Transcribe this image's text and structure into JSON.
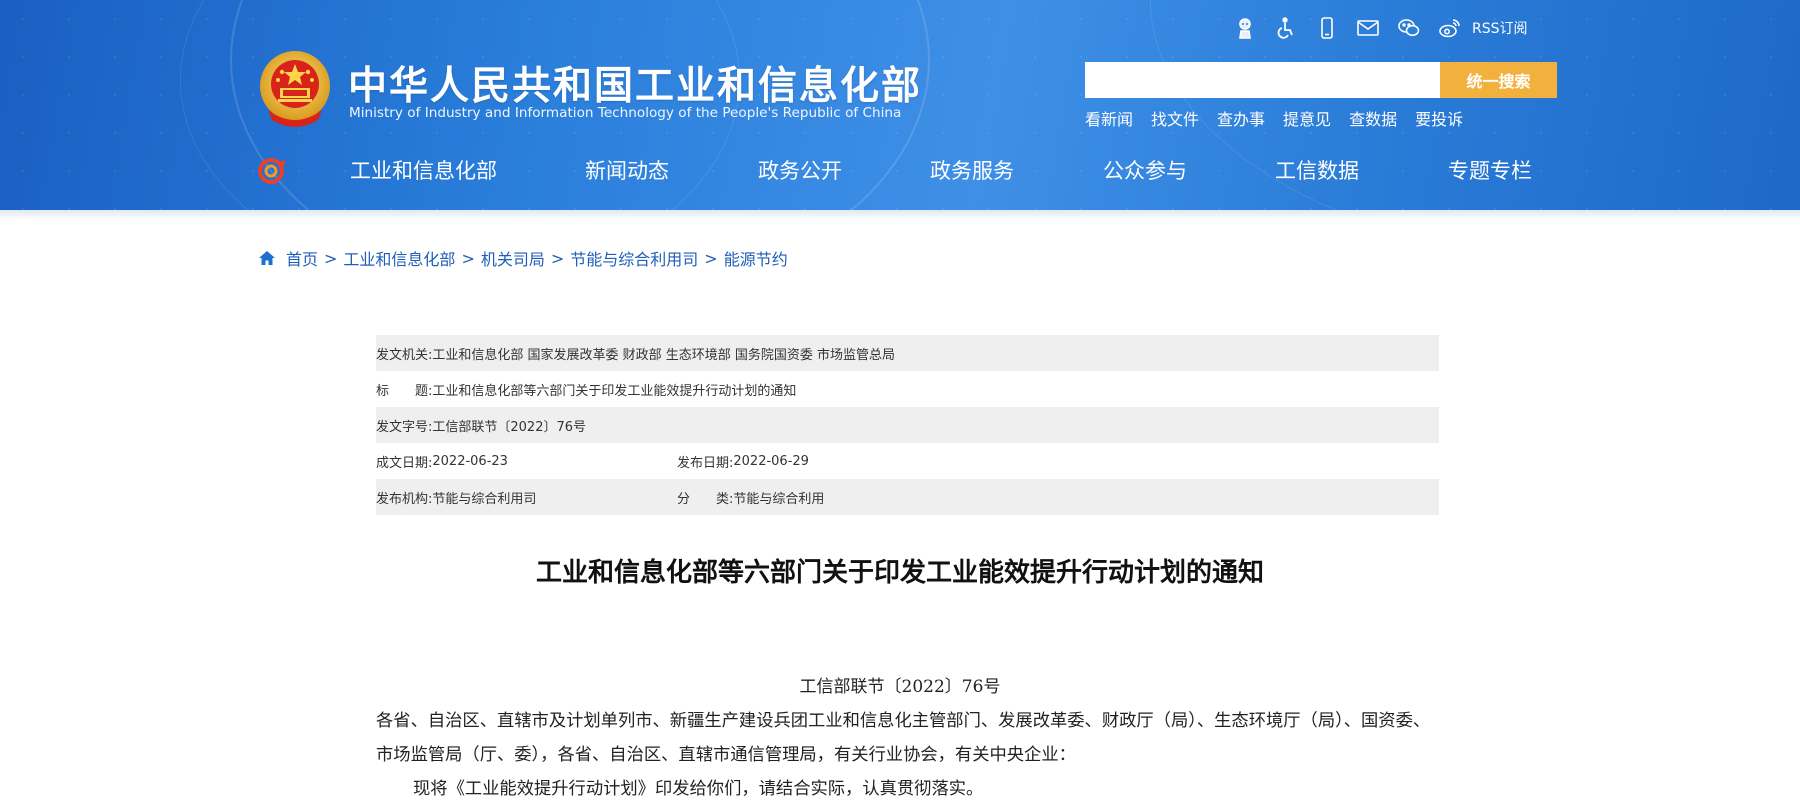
{
  "header": {
    "site_title": "中华人民共和国工业和信息化部",
    "site_subtitle": "Ministry of Industry and Information Technology of the People's Republic of China",
    "rss_label": "RSS订阅",
    "top_icons": [
      "robot-icon",
      "accessibility-icon",
      "mobile-icon",
      "mail-icon",
      "wechat-icon",
      "weibo-icon"
    ],
    "search": {
      "value": "",
      "placeholder": "",
      "button_label": "统一搜索"
    },
    "quick_links": [
      "看新闻",
      "找文件",
      "查办事",
      "提意见",
      "查数据",
      "要投诉"
    ],
    "nav": [
      "工业和信息化部",
      "新闻动态",
      "政务公开",
      "政务服务",
      "公众参与",
      "工信数据",
      "专题专栏"
    ]
  },
  "breadcrumb": {
    "items": [
      "首页",
      "工业和信息化部",
      "机关司局",
      "节能与综合利用司",
      "能源节约"
    ],
    "separator": ">"
  },
  "meta": {
    "issuer_label": "发文机关:",
    "issuer_value": "工业和信息化部 国家发展改革委 财政部 生态环境部 国务院国资委 市场监管总局",
    "title_label": "标　　题:",
    "title_value": "工业和信息化部等六部门关于印发工业能效提升行动计划的通知",
    "doc_no_label": "发文字号:",
    "doc_no_value": "工信部联节〔2022〕76号",
    "written_date_label": "成文日期:",
    "written_date_value": "2022-06-23",
    "publish_date_label": "发布日期:",
    "publish_date_value": "2022-06-29",
    "publisher_label": "发布机构:",
    "publisher_value": "节能与综合利用司",
    "category_label": "分　　类:",
    "category_value": "节能与综合利用"
  },
  "article": {
    "title": "工业和信息化部等六部门关于印发工业能效提升行动计划的通知",
    "doc_number": "工信部联节〔2022〕76号",
    "paragraph_1": "各省、自治区、直辖市及计划单列市、新疆生产建设兵团工业和信息化主管部门、发展改革委、财政厅（局）、生态环境厅（局）、国资委、市场监管局（厅、委），各省、自治区、直辖市通信管理局，有关行业协会，有关中央企业：",
    "paragraph_2": "现将《工业能效提升行动计划》印发给你们，请结合实际，认真贯彻落实。"
  },
  "colors": {
    "header_blue": "#2a7fdb",
    "search_button": "#f2b13c",
    "breadcrumb_link": "#1f5eb8",
    "meta_row_shade": "#efefef"
  }
}
